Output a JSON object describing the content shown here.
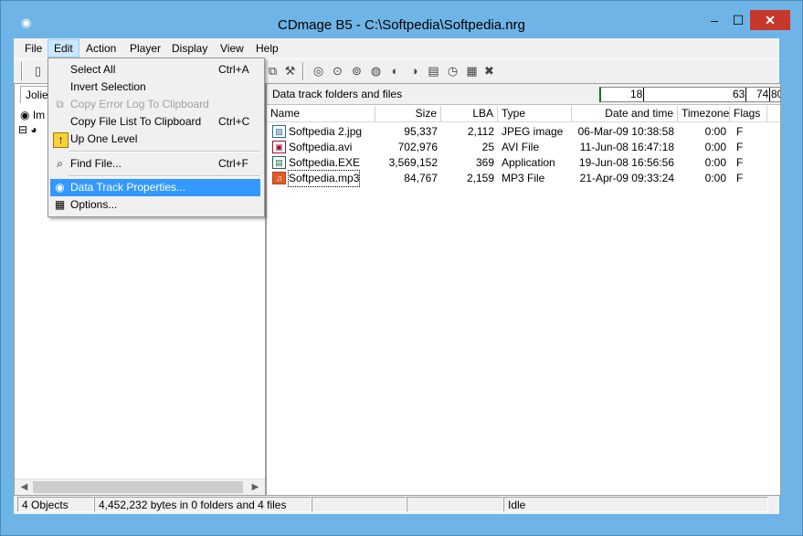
{
  "window": {
    "title": "CDmage B5 - C:\\Softpedia\\Softpedia.nrg",
    "min_glyph": "–",
    "max_glyph": "☐",
    "close_glyph": "✕"
  },
  "menubar": [
    "File",
    "Edit",
    "Action",
    "Player",
    "Display",
    "View",
    "Help"
  ],
  "left_pane": {
    "tab": "Joliet",
    "tree_root": "Im"
  },
  "right_pane": {
    "header": "Data track folders and files",
    "progress": {
      "v1": "18",
      "v2": "63",
      "v3": "74",
      "v4": "80"
    },
    "columns": [
      "Name",
      "Size",
      "LBA",
      "Type",
      "Date and time",
      "Timezone",
      "Flags"
    ],
    "files": [
      {
        "name": "Softpedia 2.jpg",
        "size": "95,337",
        "lba": "2,112",
        "type": "JPEG image",
        "date": "06-Mar-09 10:38:58",
        "tz": "0:00",
        "flags": "F",
        "icon": "image-icon"
      },
      {
        "name": "Softpedia.avi",
        "size": "702,976",
        "lba": "25",
        "type": "AVI File",
        "date": "11-Jun-08 16:47:18",
        "tz": "0:00",
        "flags": "F",
        "icon": "video-icon"
      },
      {
        "name": "Softpedia.EXE",
        "size": "3,569,152",
        "lba": "369",
        "type": "Application",
        "date": "19-Jun-08 16:56:56",
        "tz": "0:00",
        "flags": "F",
        "icon": "app-icon"
      },
      {
        "name": "Softpedia.mp3",
        "size": "84,767",
        "lba": "2,159",
        "type": "MP3 File",
        "date": "21-Apr-09 09:33:24",
        "tz": "0:00",
        "flags": "F",
        "icon": "audio-icon"
      }
    ]
  },
  "edit_menu": {
    "select_all": "Select All",
    "select_all_sc": "Ctrl+A",
    "invert": "Invert Selection",
    "copy_error": "Copy Error Log To Clipboard",
    "copy_list": "Copy File List To Clipboard",
    "copy_list_sc": "Ctrl+C",
    "up_level": "Up One Level",
    "find": "Find File...",
    "find_sc": "Ctrl+F",
    "dtp": "Data Track Properties...",
    "options": "Options..."
  },
  "status": {
    "objects": "4 Objects",
    "bytes": "4,452,232 bytes in 0 folders and 4 files",
    "state": "Idle"
  },
  "colors": {
    "title_bg": "#6fb4e6",
    "close_red": "#c7372c",
    "highlight": "#3399ff"
  }
}
